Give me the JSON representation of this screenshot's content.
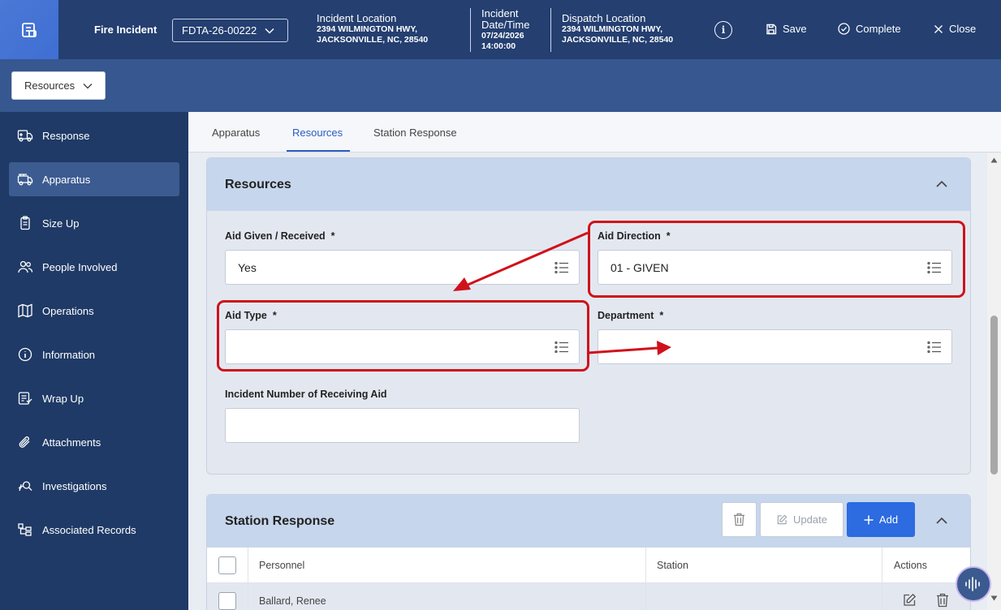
{
  "header": {
    "incident_type": "Fire Incident",
    "incident_number": "FDTA-26-00222",
    "incident_location_label": "Incident Location",
    "incident_location_line1": "2394 WILMINGTON HWY,",
    "incident_location_line2": "JACKSONVILLE, NC, 28540",
    "incident_datetime_label1": "Incident",
    "incident_datetime_label2": "Date/Time",
    "incident_date": "07/24/2026",
    "incident_time": "14:00:00",
    "dispatch_location_label": "Dispatch Location",
    "dispatch_location_line1": "2394 WILMINGTON HWY,",
    "dispatch_location_line2": "JACKSONVILLE, NC, 28540",
    "save_label": "Save",
    "complete_label": "Complete",
    "close_label": "Close"
  },
  "section_select": {
    "value": "Resources"
  },
  "sidebar": {
    "items": [
      {
        "label": "Response",
        "icon": "truck-icon"
      },
      {
        "label": "Apparatus",
        "icon": "fire-engine-icon",
        "active": true
      },
      {
        "label": "Size Up",
        "icon": "clipboard-icon"
      },
      {
        "label": "People Involved",
        "icon": "people-icon"
      },
      {
        "label": "Operations",
        "icon": "map-icon"
      },
      {
        "label": "Information",
        "icon": "info-icon"
      },
      {
        "label": "Wrap Up",
        "icon": "wrap-up-icon"
      },
      {
        "label": "Attachments",
        "icon": "paperclip-icon"
      },
      {
        "label": "Investigations",
        "icon": "investigation-icon"
      },
      {
        "label": "Associated Records",
        "icon": "records-icon"
      }
    ]
  },
  "tabs": [
    {
      "label": "Apparatus"
    },
    {
      "label": "Resources",
      "active": true
    },
    {
      "label": "Station Response"
    }
  ],
  "resources_card": {
    "title": "Resources",
    "aid_given_label": "Aid Given / Received",
    "aid_given_value": "Yes",
    "aid_direction_label": "Aid Direction",
    "aid_direction_value": "01 - GIVEN",
    "aid_type_label": "Aid Type",
    "aid_type_value": "",
    "department_label": "Department",
    "department_value": "",
    "receiving_aid_label": "Incident Number of Receiving Aid",
    "receiving_aid_value": "",
    "required_marker": "*"
  },
  "station_card": {
    "title": "Station Response",
    "update_label": "Update",
    "add_label": "Add",
    "columns": [
      "Personnel",
      "Station",
      "Actions"
    ],
    "rows": [
      {
        "personnel": "Ballard, Renee",
        "station": ""
      }
    ]
  },
  "colors": {
    "header_bg": "#243f70",
    "sidebar_bg": "#1f3a66",
    "accent": "#2b5cc4",
    "annotation": "#d0111a"
  }
}
